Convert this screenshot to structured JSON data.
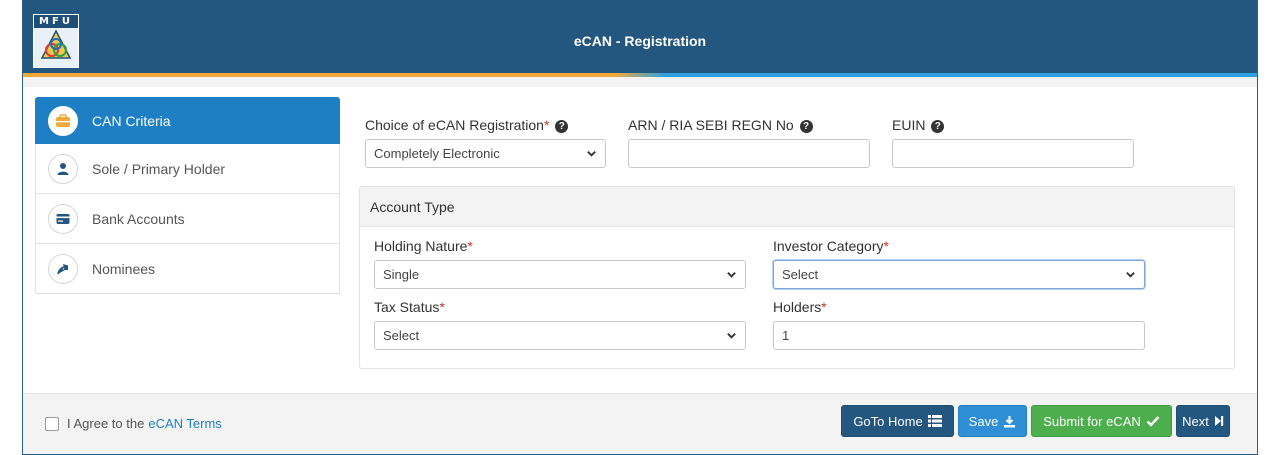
{
  "header": {
    "title": "eCAN - Registration",
    "logo_text": "MFU"
  },
  "sidebar": {
    "items": [
      {
        "label": "CAN Criteria",
        "icon": "briefcase-icon",
        "active": true
      },
      {
        "label": "Sole / Primary Holder",
        "icon": "user-icon"
      },
      {
        "label": "Bank Accounts",
        "icon": "card-icon"
      },
      {
        "label": "Nominees",
        "icon": "arrow-icon"
      }
    ]
  },
  "form": {
    "choice_label": "Choice of eCAN Registration",
    "choice_value": "Completely Electronic",
    "arn_label": "ARN / RIA SEBI REGN No",
    "arn_value": "",
    "euin_label": "EUIN",
    "euin_value": "",
    "required_mark": "*",
    "help_glyph": "?"
  },
  "account_type": {
    "title": "Account Type",
    "holding_nature_label": "Holding Nature",
    "holding_nature_value": "Single",
    "investor_category_label": "Investor Category",
    "investor_category_value": "Select",
    "tax_status_label": "Tax Status",
    "tax_status_value": "Select",
    "holders_label": "Holders",
    "holders_value": "1"
  },
  "footer": {
    "agree_text": "I Agree to the",
    "terms_link": "eCAN Terms",
    "home_button": "GoTo Home",
    "save_button": "Save",
    "submit_button": "Submit for eCAN",
    "next_button": "Next"
  },
  "colors": {
    "header": "#24577f",
    "primary": "#1f7fc4",
    "success": "#4cae4c",
    "required": "#c0392b"
  }
}
